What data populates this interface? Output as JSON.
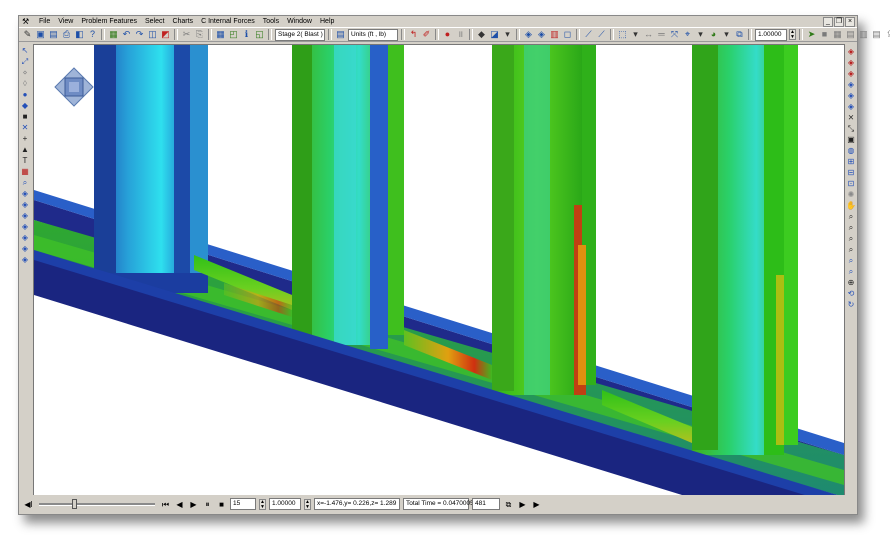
{
  "menu": {
    "items": [
      "File",
      "View",
      "Problem Features",
      "Select",
      "Charts",
      "C Internal Forces",
      "Tools",
      "Window",
      "Help"
    ]
  },
  "toolbar": {
    "stage_value": "Stage 2( Blast )",
    "units_label": "Units (ft , lb)",
    "scale_value": "1.00000"
  },
  "status": {
    "frame_value": "15",
    "speed_value": "1.00000",
    "coords": "x=-1.476,y= 0.226,z= 1.289",
    "total_time": "Total Time = 0.0470005",
    "step_value": "481"
  },
  "playback": {
    "slider_fraction": 0.3
  },
  "colors": {
    "chrome": "#d4d0c8",
    "beam_blue": "#1a2580",
    "steel_green": "#32cc18",
    "steel_cyan": "#2ad6e8",
    "hot_red": "#d03010"
  },
  "icons": {
    "left_toolbar": [
      "select-icon",
      "pan-icon",
      "node-icon",
      "shape-icon",
      "square-icon",
      "cross-icon",
      "plus-icon",
      "arrow-icon",
      "text-icon",
      "palette-icon",
      "zoom-icon",
      "cube-a-icon",
      "cube-b-icon",
      "cube-c-icon",
      "cube-d-icon",
      "cube-e-icon",
      "cube-f-icon",
      "cube-g-icon"
    ],
    "right_toolbar": [
      "cube-red-icon",
      "cube-red2-icon",
      "cube-red3-icon",
      "cube-blue-icon",
      "cube-blue2-icon",
      "cube-blue3-icon",
      "axis-icon",
      "plot-icon",
      "chart-icon",
      "globe-icon",
      "fit-icon",
      "grid-icon",
      "view-icon",
      "light-icon",
      "hand-icon",
      "zoom-in-icon",
      "zoom-out-icon",
      "zoom-box-icon",
      "zoom-fit-icon",
      "zoom-all-icon",
      "zoom-prev-icon",
      "rotate-icon",
      "spin-icon"
    ]
  }
}
